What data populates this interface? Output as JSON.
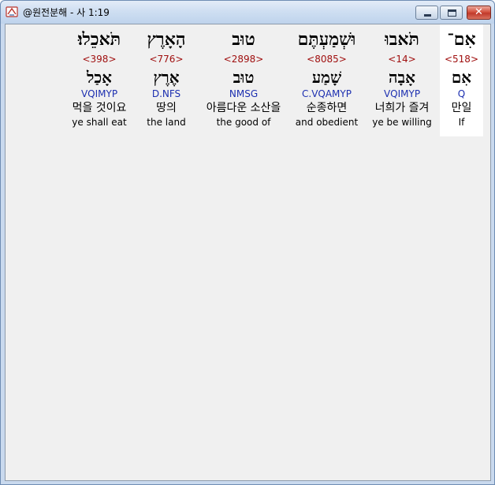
{
  "window": {
    "title": "@원전분해 - 사 1:19",
    "icon": "app-book-icon",
    "controls": {
      "minimize": "minimize-icon",
      "maximize": "maximize-icon",
      "close": "close-icon"
    }
  },
  "colors": {
    "strong": "#a01010",
    "morph": "#1c2fb0",
    "selected_bg": "#ffffff"
  },
  "words": [
    {
      "hebrew": "אִם־",
      "strong": "<518>",
      "lemma": "אִם",
      "morph": "Q",
      "korean": "만일",
      "english": "If",
      "selected": true
    },
    {
      "hebrew": "תֹּאבוּ",
      "strong": "<14>",
      "lemma": "אָבָה",
      "morph": "VQIMYP",
      "korean": "너희가 즐겨",
      "english": "ye be willing",
      "selected": false
    },
    {
      "hebrew": "וּשְׁמַעְתֶּם",
      "strong": "<8085>",
      "lemma": "שָׁמַע",
      "morph": "C.VQAMYP",
      "korean": "순종하면",
      "english": "and obedient",
      "selected": false
    },
    {
      "hebrew": "טוּב",
      "strong": "<2898>",
      "lemma": "טוּב",
      "morph": "NMSG",
      "korean": "아름다운 소산을",
      "english": "the good of",
      "selected": false
    },
    {
      "hebrew": "הָאָרֶץ",
      "strong": "<776>",
      "lemma": "אֶרֶץ",
      "morph": "D.NFS",
      "korean": "땅의",
      "english": "the land",
      "selected": false
    },
    {
      "hebrew": "תֹּאכֵלוּ׃",
      "strong": "<398>",
      "lemma": "אָכַל",
      "morph": "VQIMYP",
      "korean": "먹을 것이요",
      "english": "ye shall eat",
      "selected": false
    }
  ]
}
